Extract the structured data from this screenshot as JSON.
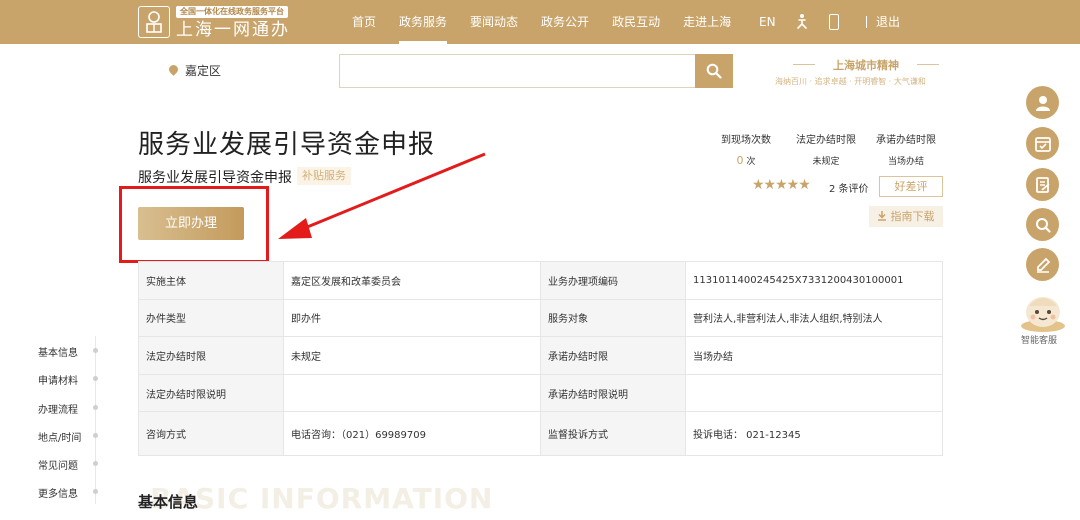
{
  "header": {
    "logo_small": "全国一体化在线政务服务平台",
    "logo_big": "上海一网通办",
    "nav": [
      "首页",
      "政务服务",
      "要闻动态",
      "政务公开",
      "政民互动",
      "走进上海"
    ],
    "lang": "EN",
    "exit": "退出"
  },
  "search": {
    "location": "嘉定区",
    "slogan_title": "上海城市精神",
    "slogan_sub": "海纳百川 · 追求卓越 · 开明睿智 · 大气谦和"
  },
  "service": {
    "title": "服务业发展引导资金申报",
    "subtitle": "服务业发展引导资金申报",
    "tag": "补贴服务",
    "apply": "立即办理"
  },
  "stats": [
    {
      "label": "到现场次数",
      "num": "0",
      "unit": "次"
    },
    {
      "label": "法定办结时限",
      "value": "未规定"
    },
    {
      "label": "承诺办结时限",
      "value": "当场办结"
    }
  ],
  "rating": {
    "stars": "★★★★★",
    "count": "2 条评价",
    "rate_btn": "好差评",
    "guide": "指南下载"
  },
  "table": [
    [
      "实施主体",
      "嘉定区发展和改革委员会",
      "业务办理项编码",
      "11310114002454​25X7331200430100001"
    ],
    [
      "办件类型",
      "即办件",
      "服务对象",
      "营利法人,非营利法人,非法人组织,特别法人"
    ],
    [
      "法定办结时限",
      "未规定",
      "承诺办结时限",
      "当场办结"
    ],
    [
      "法定办结时限说明",
      "",
      "承诺办结时限说明",
      ""
    ],
    [
      "咨询方式",
      "电话咨询：（021）69989709",
      "监督投诉方式",
      "投诉电话：  021-12345"
    ]
  ],
  "anchors": [
    "基本信息",
    "申请材料",
    "办理流程",
    "地点/时间",
    "常见问题",
    "更多信息"
  ],
  "section": {
    "title": "基本信息",
    "bg": "BASIC INFORMATION"
  },
  "assistant": "智能客服",
  "colors": {
    "gold": "#c9a46a",
    "red": "#e31b1b"
  }
}
